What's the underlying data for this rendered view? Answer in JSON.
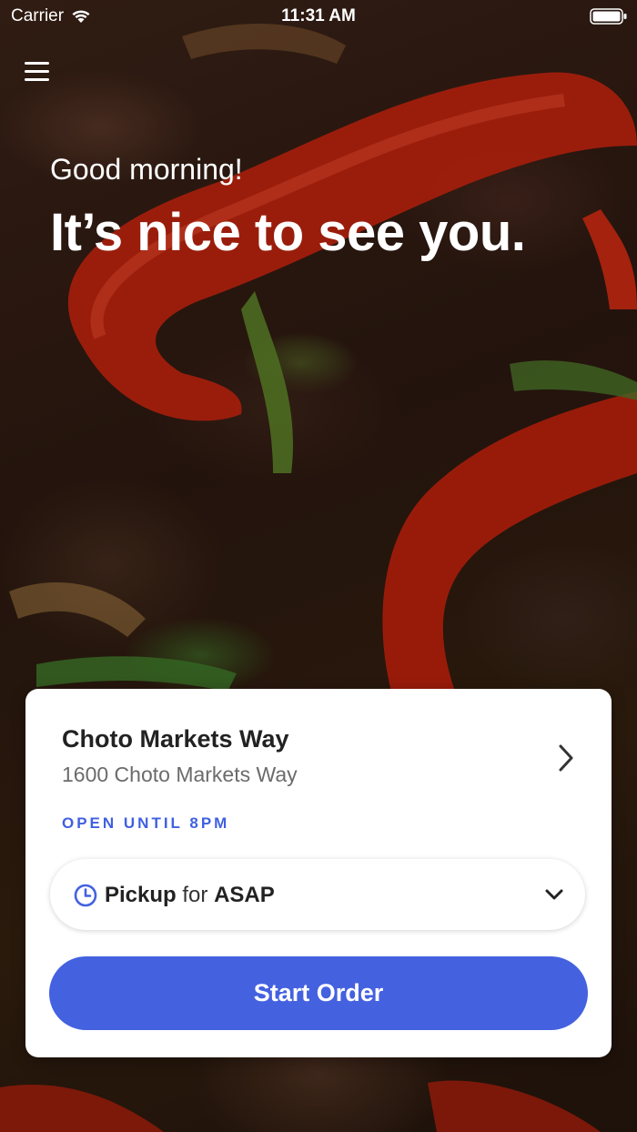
{
  "status_bar": {
    "carrier": "Carrier",
    "time": "11:31 AM"
  },
  "header": {
    "menu_icon": "hamburger-menu-icon",
    "greeting": "Good morning!",
    "headline": "It’s nice to see you."
  },
  "store_card": {
    "store_name": "Choto Markets Way",
    "store_address": "1600 Choto Markets Way",
    "open_status": "OPEN UNTIL 8PM",
    "pickup": {
      "mode": "Pickup",
      "connector": "for",
      "time": "ASAP",
      "icon": "clock-icon"
    },
    "start_button_label": "Start Order"
  },
  "colors": {
    "accent": "#4461e0",
    "open_status": "#4060e0",
    "card_background": "#ffffff"
  }
}
